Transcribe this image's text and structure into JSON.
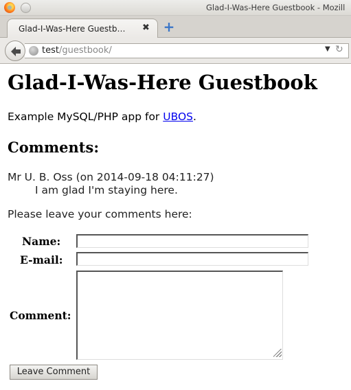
{
  "window": {
    "title": "Glad-I-Was-Here Guestbook - Mozill"
  },
  "tabs": [
    {
      "label": "Glad-I-Was-Here Guestb…"
    }
  ],
  "addressbar": {
    "host": "test",
    "path": "/guestbook/"
  },
  "page": {
    "title": "Glad-I-Was-Here Guestbook",
    "intro_prefix": "Example MySQL/PHP app for ",
    "intro_link": "UBOS",
    "intro_suffix": ".",
    "comments_heading": "Comments:",
    "comments": [
      {
        "meta": "Mr U. B. Oss (on 2014-09-18 04:11:27)",
        "text": "I am glad I'm staying here."
      }
    ],
    "prompt": "Please leave your comments here:"
  },
  "form": {
    "name_label": "Name:",
    "email_label": "E-mail:",
    "comment_label": "Comment:",
    "name_value": "",
    "email_value": "",
    "comment_value": "",
    "submit_label": "Leave Comment"
  },
  "colors": {
    "link": "#0000ee",
    "newtab_icon": "#3b76c7"
  }
}
